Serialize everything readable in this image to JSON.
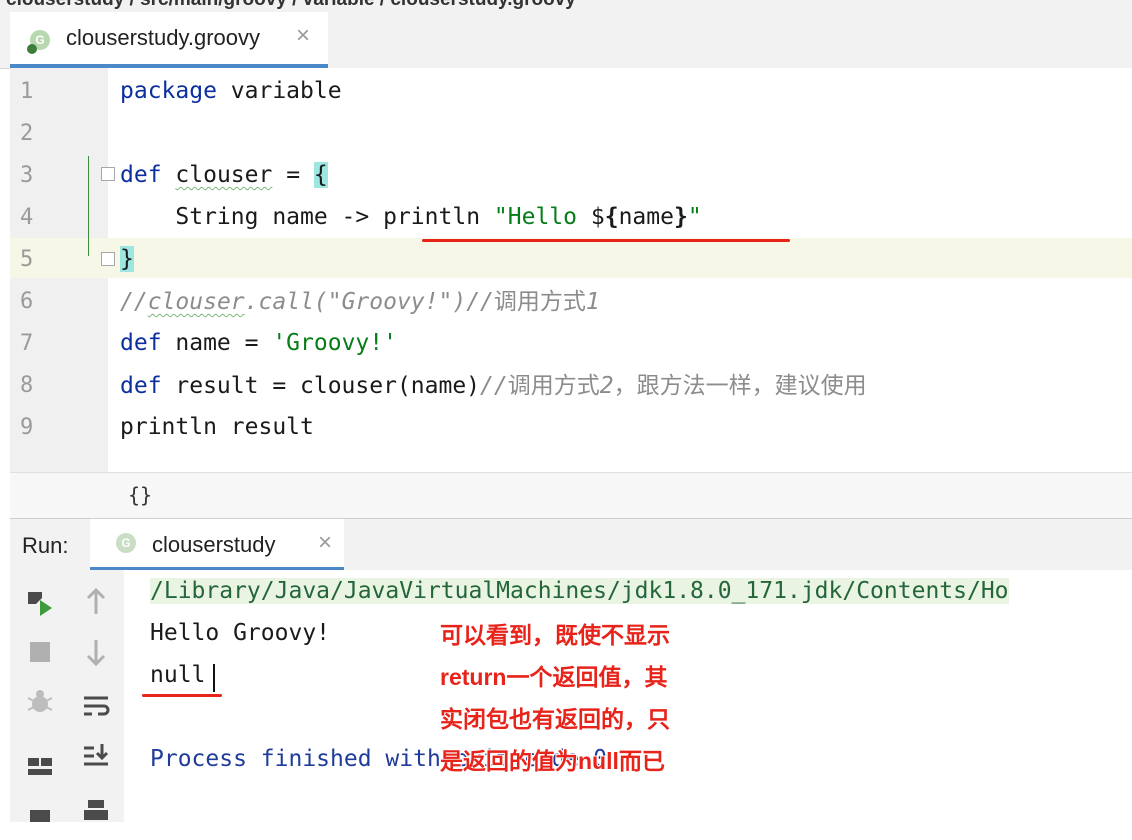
{
  "breadcrumb": {
    "text": "clouserstudy / src/main/groovy / variable / clouserstudy.groovy"
  },
  "editor_tab": {
    "label": "clouserstudy.groovy",
    "icon": "groovy-file-icon",
    "close": "×"
  },
  "editor": {
    "line_numbers": [
      "1",
      "2",
      "3",
      "4",
      "5",
      "6",
      "7",
      "8",
      "9"
    ],
    "lines": {
      "l1": {
        "kw": "package",
        "rest": " variable"
      },
      "l3": {
        "kw": "def",
        "sp": " ",
        "name": "clouser",
        "eq": " = ",
        "brace": "{"
      },
      "l4": {
        "indent": "    String name -> ",
        "fn": "println",
        "sp": " ",
        "str1": "\"Hello ",
        "dollar": "$",
        "brace_open": "{",
        "var": "name",
        "brace_close": "}",
        "str2": "\""
      },
      "l5": {
        "brace": "}"
      },
      "l6": {
        "c1": "//",
        "c2": "clouser",
        "c3": ".call(\"Groovy!\")//",
        "c4": "调用方式",
        "c5": "1"
      },
      "l7": {
        "kw": "def",
        "rest": " name = ",
        "str": "'Groovy!'"
      },
      "l8": {
        "kw": "def",
        "rest": " result = clouser(name)",
        "c1": "//",
        "c2": "调用方式",
        "c3": "2",
        "c4": "，跟方法一样，建议使用"
      },
      "l9": {
        "text": "println result"
      }
    }
  },
  "structure_bar": {
    "icon_text": "{}"
  },
  "run": {
    "label": "Run:",
    "tab_label": "clouserstudy",
    "tab_icon_text": "G",
    "close": "×"
  },
  "console": {
    "path": "/Library/Java/JavaVirtualMachines/jdk1.8.0_171.jdk/Contents/Ho",
    "hello": "Hello Groovy!",
    "null_text": "null",
    "process": "Process finished with exit code 0"
  },
  "annotation": {
    "lines": [
      "可以看到，既使不显示",
      "return一个返回值，其",
      "实闭包也有返回的，只",
      "是返回的值为null而已"
    ],
    "color": "#e8231a"
  },
  "colors": {
    "keyword": "#0b2f9e",
    "string": "#067d17",
    "comment": "#8c8c8c",
    "accent": "#4a88c7"
  }
}
